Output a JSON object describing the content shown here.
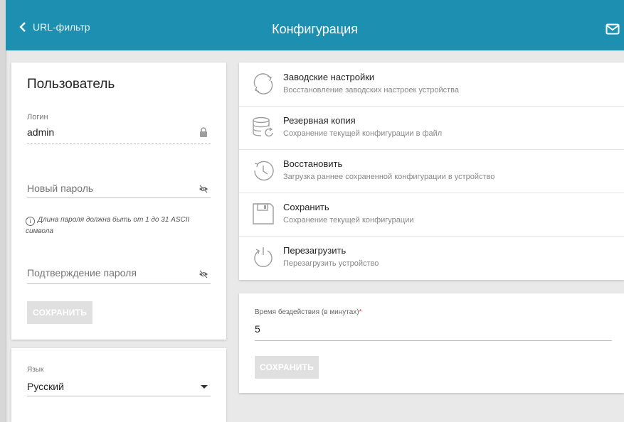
{
  "header": {
    "back_label": "URL-фильтр",
    "title": "Конфигурация",
    "bg_color": "#1d8fb0"
  },
  "user_card": {
    "heading": "Пользователь",
    "login_label": "Логин",
    "login_value": "admin",
    "new_password_placeholder": "Новый пароль",
    "hint": "Длина пароля должна быть от 1 до 31 ASCII символа",
    "confirm_password_placeholder": "Подтверждение пароля",
    "save_label": "СОХРАНИТЬ"
  },
  "language_card": {
    "label": "Язык",
    "selected": "Русский"
  },
  "config_items": [
    {
      "icon": "factory-reset-icon",
      "title": "Заводские настройки",
      "subtitle": "Восстановление заводских настроек устройства"
    },
    {
      "icon": "backup-icon",
      "title": "Резервная копия",
      "subtitle": "Сохранение текущей конфигурации в файл"
    },
    {
      "icon": "restore-icon",
      "title": "Восстановить",
      "subtitle": "Загрузка раннее сохраненной конфигурации в устройство"
    },
    {
      "icon": "save-icon",
      "title": "Сохранить",
      "subtitle": "Сохранение текущей конфигурации"
    },
    {
      "icon": "reboot-icon",
      "title": "Перезагрузить",
      "subtitle": "Перезагрузить устройство"
    }
  ],
  "timeout_card": {
    "label": "Время бездействия (в минутах)",
    "required_mark": "*",
    "value": "5",
    "save_label": "СОХРАНИТЬ"
  }
}
